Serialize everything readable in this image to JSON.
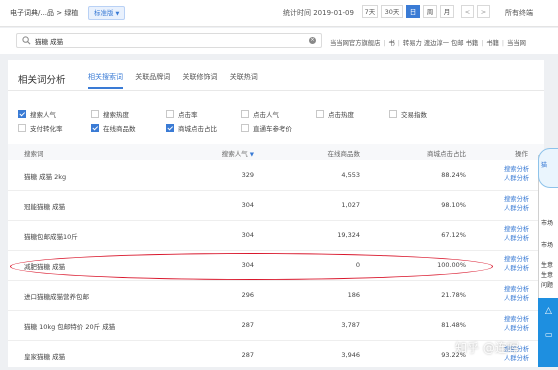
{
  "topbar": {
    "breadcrumb": "电子词典/...品 > 绿植",
    "badge": "标准版",
    "stat_label": "统计时间 2019-01-09",
    "periods": [
      "7天",
      "30天",
      "日",
      "周",
      "月"
    ],
    "active_period": "日",
    "prev": "<",
    "next": ">",
    "terminal": "所有终端"
  },
  "search": {
    "value": "猫糖 成猫",
    "shops": [
      "当当网官方旗舰店",
      "书",
      "转易力 渡边淳一 包邮 书籍",
      "书籍",
      "当当网"
    ]
  },
  "panel": {
    "title": "相关词分析",
    "tabs": [
      "相关搜索词",
      "关联品牌词",
      "关联修饰词",
      "关联热词"
    ],
    "active_tab": "相关搜索词"
  },
  "metrics": [
    {
      "label": "搜索人气",
      "checked": true
    },
    {
      "label": "搜索热度",
      "checked": false
    },
    {
      "label": "点击率",
      "checked": false
    },
    {
      "label": "点击人气",
      "checked": false
    },
    {
      "label": "点击热度",
      "checked": false
    },
    {
      "label": "交易指数",
      "checked": false
    },
    {
      "label": "支付转化率",
      "checked": false
    },
    {
      "label": "在线商品数",
      "checked": true
    },
    {
      "label": "商城点击占比",
      "checked": true
    },
    {
      "label": "直通车参考价",
      "checked": false
    }
  ],
  "table": {
    "headers": {
      "keyword": "搜索词",
      "popularity": "搜索人气",
      "sort_icon": "▼",
      "products": "在线商品数",
      "mall_ctr": "商城点击占比",
      "actions": "操作"
    },
    "action_links": [
      "搜索分析",
      "人群分析"
    ],
    "rows": [
      {
        "keyword": "猫糖 成猫 2kg",
        "popularity": "329",
        "products": "4,553",
        "mall_ctr": "88.24%"
      },
      {
        "keyword": "冠能猫糖 成猫",
        "popularity": "304",
        "products": "1,027",
        "mall_ctr": "98.10%"
      },
      {
        "keyword": "猫糖包邮成猫10斤",
        "popularity": "304",
        "products": "19,324",
        "mall_ctr": "67.12%"
      },
      {
        "keyword": "减肥猫糖 成猫",
        "popularity": "304",
        "products": "0",
        "mall_ctr": "100.00%"
      },
      {
        "keyword": "进口猫糖成猫营养包邮",
        "popularity": "296",
        "products": "186",
        "mall_ctr": "21.78%"
      },
      {
        "keyword": "猫糖 10kg 包邮特价 20斤 成猫",
        "popularity": "287",
        "products": "3,787",
        "mall_ctr": "81.48%"
      },
      {
        "keyword": "皇家猫糖 成猫",
        "popularity": "287",
        "products": "3,946",
        "mall_ctr": "93.22%"
      }
    ]
  },
  "side": {
    "lines": [
      "猫",
      "市场",
      "市场",
      "生意",
      "生意",
      "问题"
    ]
  },
  "watermark": "知乎 @连晖",
  "colors": {
    "accent": "#3a7bd5",
    "highlight": "#d9182d",
    "side_blue": "#1e8fe0"
  }
}
